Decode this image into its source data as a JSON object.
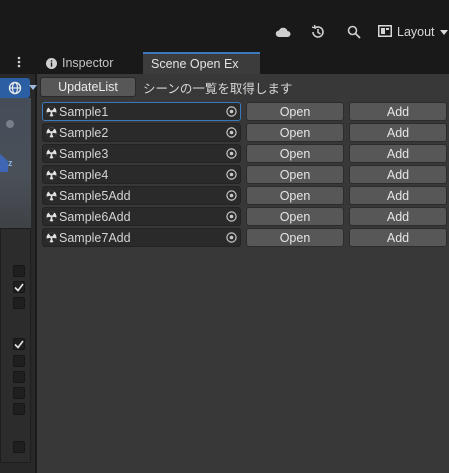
{
  "toolbar": {
    "icons": [
      "cloud-icon",
      "history-icon",
      "search-icon",
      "layout-icon"
    ],
    "layout_label": "Layout"
  },
  "tabs": {
    "inspector_label": "Inspector",
    "scene_open_label": "Scene Open Ex"
  },
  "scene_panel": {
    "axis_label": "z"
  },
  "main": {
    "update_button_label": "UpdateList",
    "hint_text": "シーンの一覧を取得します",
    "rows": [
      {
        "scene": "Sample1",
        "open_label": "Open",
        "add_label": "Add"
      },
      {
        "scene": "Sample2",
        "open_label": "Open",
        "add_label": "Add"
      },
      {
        "scene": "Sample3",
        "open_label": "Open",
        "add_label": "Add"
      },
      {
        "scene": "Sample4",
        "open_label": "Open",
        "add_label": "Add"
      },
      {
        "scene": "Sample5Add",
        "open_label": "Open",
        "add_label": "Add"
      },
      {
        "scene": "Sample6Add",
        "open_label": "Open",
        "add_label": "Add"
      },
      {
        "scene": "Sample7Add",
        "open_label": "Open",
        "add_label": "Add"
      }
    ]
  },
  "colors": {
    "background": "#383838",
    "button": "#575757",
    "field": "#2a2a2a",
    "accent": "#3a79bb"
  }
}
